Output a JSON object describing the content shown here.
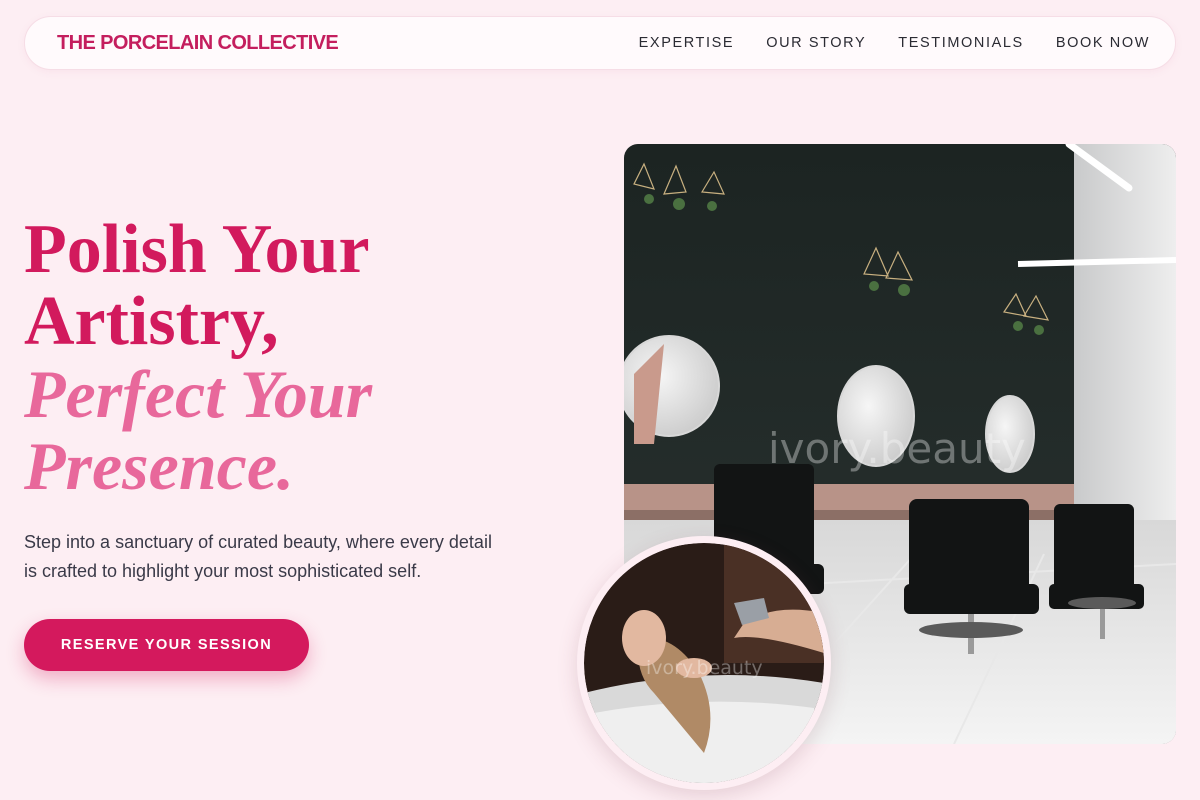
{
  "nav": {
    "brand": "THE PORCELAIN COLLECTIVE",
    "links": [
      "EXPERTISE",
      "OUR STORY",
      "TESTIMONIALS",
      "BOOK NOW"
    ]
  },
  "hero": {
    "headline_line1": "Polish Your",
    "headline_line2": "Artistry,",
    "headline_line3": "Perfect Your",
    "headline_line4": "Presence.",
    "lead": "Step into a sanctuary of curated beauty, where every detail is crafted to highlight your most sophisticated self.",
    "cta_label": "RESERVE YOUR SESSION"
  },
  "images": {
    "main_watermark": "ivory.beauty",
    "circle_watermark": "ivory.beauty"
  },
  "colors": {
    "page_bg": "#fdeef3",
    "brand": "#c41e5e",
    "headline_bold": "#d21a5d",
    "headline_italic": "#e8689b",
    "cta_bg": "#d4195d"
  }
}
